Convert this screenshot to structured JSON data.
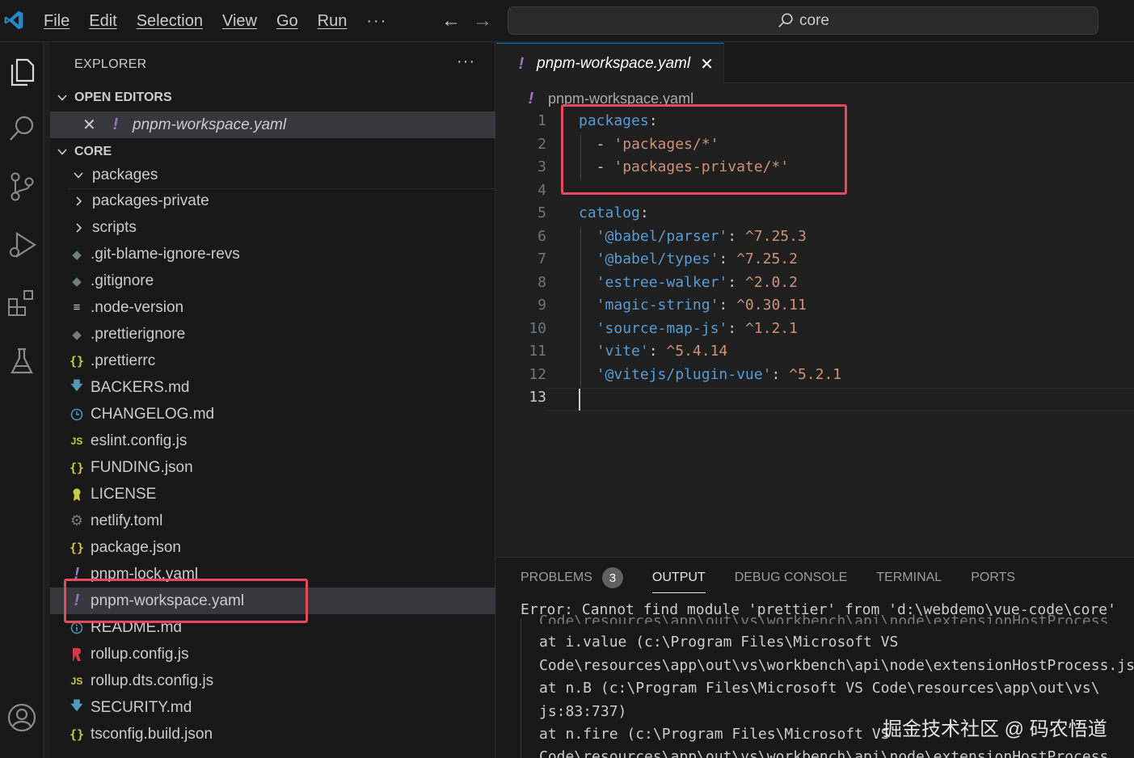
{
  "menu": [
    "File",
    "Edit",
    "Selection",
    "View",
    "Go",
    "Run"
  ],
  "menu_more": "···",
  "search": {
    "text": "core"
  },
  "sidebar": {
    "title": "EXPLORER",
    "more": "···",
    "open_editors_label": "OPEN EDITORS",
    "open_editor_file": "pnpm-workspace.yaml",
    "root_label": "CORE",
    "items": [
      {
        "label": "packages",
        "icon": "chevron-down-icon"
      },
      {
        "label": "packages-private",
        "icon": "chevron-right-icon"
      },
      {
        "label": "scripts",
        "icon": "chevron-right-icon"
      },
      {
        "label": ".git-blame-ignore-revs",
        "icon": "git-icon"
      },
      {
        "label": ".gitignore",
        "icon": "git-icon"
      },
      {
        "label": ".node-version",
        "icon": "lines-icon"
      },
      {
        "label": ".prettierignore",
        "icon": "git-icon"
      },
      {
        "label": ".prettierrc",
        "icon": "braces-icon"
      },
      {
        "label": "BACKERS.md",
        "icon": "download-icon"
      },
      {
        "label": "CHANGELOG.md",
        "icon": "clock-icon"
      },
      {
        "label": "eslint.config.js",
        "icon": "js-icon"
      },
      {
        "label": "FUNDING.json",
        "icon": "braces-icon"
      },
      {
        "label": "LICENSE",
        "icon": "license-icon"
      },
      {
        "label": "netlify.toml",
        "icon": "gear-icon"
      },
      {
        "label": "package.json",
        "icon": "braces-icon"
      },
      {
        "label": "pnpm-lock.yaml",
        "icon": "yaml-icon"
      },
      {
        "label": "pnpm-workspace.yaml",
        "icon": "yaml-icon"
      },
      {
        "label": "README.md",
        "icon": "info-icon"
      },
      {
        "label": "rollup.config.js",
        "icon": "rollup-icon"
      },
      {
        "label": "rollup.dts.config.js",
        "icon": "js-icon"
      },
      {
        "label": "SECURITY.md",
        "icon": "download-icon"
      },
      {
        "label": "tsconfig.build.json",
        "icon": "braces-icon"
      }
    ]
  },
  "editor": {
    "tab_label": "pnpm-workspace.yaml",
    "breadcrumb": "pnpm-workspace.yaml",
    "lines": [
      {
        "n": "1",
        "parts": [
          [
            "k",
            "packages"
          ],
          [
            "p",
            ":"
          ]
        ]
      },
      {
        "n": "2",
        "parts": [
          [
            "p",
            "  - "
          ],
          [
            "s",
            "'packages/*'"
          ]
        ]
      },
      {
        "n": "3",
        "parts": [
          [
            "p",
            "  - "
          ],
          [
            "s",
            "'packages-private/*'"
          ]
        ]
      },
      {
        "n": "4",
        "parts": []
      },
      {
        "n": "5",
        "parts": [
          [
            "k",
            "catalog"
          ],
          [
            "p",
            ":"
          ]
        ]
      },
      {
        "n": "6",
        "parts": [
          [
            "p",
            "  "
          ],
          [
            "k",
            "'@babel/parser'"
          ],
          [
            "p",
            ": "
          ],
          [
            "s",
            "^7.25.3"
          ]
        ]
      },
      {
        "n": "7",
        "parts": [
          [
            "p",
            "  "
          ],
          [
            "k",
            "'@babel/types'"
          ],
          [
            "p",
            ": "
          ],
          [
            "s",
            "^7.25.2"
          ]
        ]
      },
      {
        "n": "8",
        "parts": [
          [
            "p",
            "  "
          ],
          [
            "k",
            "'estree-walker'"
          ],
          [
            "p",
            ": "
          ],
          [
            "s",
            "^2.0.2"
          ]
        ]
      },
      {
        "n": "9",
        "parts": [
          [
            "p",
            "  "
          ],
          [
            "k",
            "'magic-string'"
          ],
          [
            "p",
            ": "
          ],
          [
            "s",
            "^0.30.11"
          ]
        ]
      },
      {
        "n": "10",
        "parts": [
          [
            "p",
            "  "
          ],
          [
            "k",
            "'source-map-js'"
          ],
          [
            "p",
            ": "
          ],
          [
            "s",
            "^1.2.1"
          ]
        ]
      },
      {
        "n": "11",
        "parts": [
          [
            "p",
            "  "
          ],
          [
            "k",
            "'vite'"
          ],
          [
            "p",
            ": "
          ],
          [
            "s",
            "^5.4.14"
          ]
        ]
      },
      {
        "n": "12",
        "parts": [
          [
            "p",
            "  "
          ],
          [
            "k",
            "'@vitejs/plugin-vue'"
          ],
          [
            "p",
            ": "
          ],
          [
            "s",
            "^5.2.1"
          ]
        ]
      },
      {
        "n": "13",
        "parts": []
      }
    ]
  },
  "panel": {
    "tabs": [
      "PROBLEMS",
      "OUTPUT",
      "DEBUG CONSOLE",
      "TERMINAL",
      "PORTS"
    ],
    "problems_count": "3",
    "output_lines": [
      "Error: Cannot find module 'prettier' from 'd:\\webdemo\\vue-code\\core'",
      "Code\\resources\\app\\out\\vs\\workbench\\api\\node\\extensionHostProcess",
      "at i.value (c:\\Program Files\\Microsoft VS",
      "Code\\resources\\app\\out\\vs\\workbench\\api\\node\\extensionHostProcess.js",
      "at n.B (c:\\Program Files\\Microsoft VS Code\\resources\\app\\out\\vs\\",
      "js:83:737)",
      "at n.fire (c:\\Program Files\\Microsoft VS",
      "Code\\resources\\app\\out\\vs\\workbench\\api\\node\\extensionHostProcess"
    ]
  },
  "watermark": "掘金技术社区 @ 码农悟道"
}
